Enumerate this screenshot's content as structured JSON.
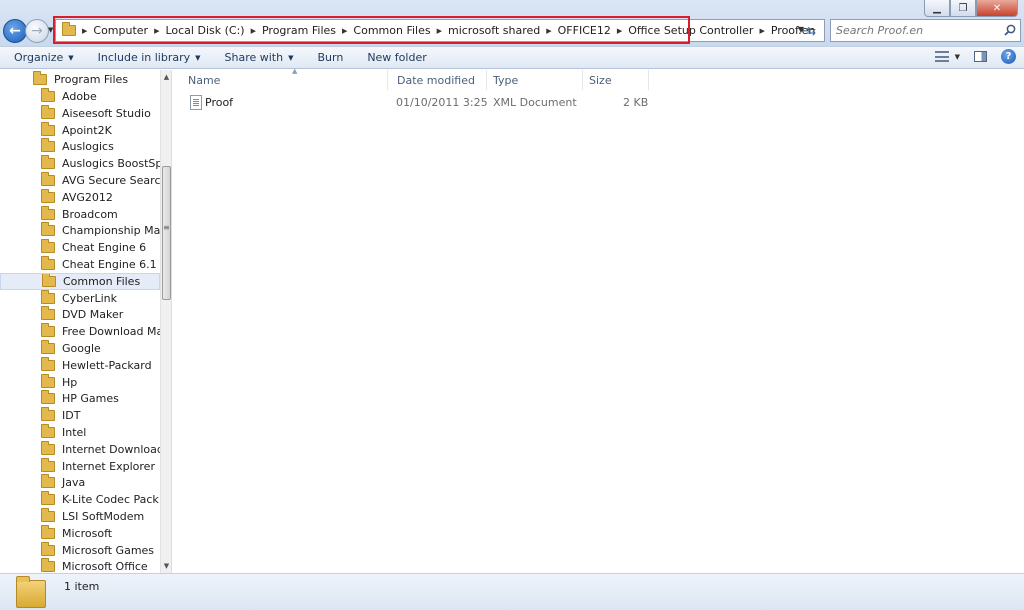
{
  "window": {
    "minimize_glyph": "▁",
    "maximize_glyph": "❐",
    "close_glyph": "✕"
  },
  "address_bar": {
    "crumbs": [
      "Computer",
      "Local Disk (C:)",
      "Program Files",
      "Common Files",
      "microsoft shared",
      "OFFICE12",
      "Office Setup Controller",
      "Proof.en"
    ]
  },
  "search": {
    "placeholder": "Search Proof.en"
  },
  "toolbar": {
    "organize": "Organize",
    "include_in_library": "Include in library",
    "share_with": "Share with",
    "burn": "Burn",
    "new_folder": "New folder"
  },
  "nav_tree": {
    "root": "Program Files",
    "selected": "Common Files",
    "items": [
      "Adobe",
      "Aiseesoft Studio",
      "Apoint2K",
      "Auslogics",
      "Auslogics BoostSpeed",
      "AVG Secure Search",
      "AVG2012",
      "Broadcom",
      "Championship Manager",
      "Cheat Engine 6",
      "Cheat Engine 6.1",
      "Common Files",
      "CyberLink",
      "DVD Maker",
      "Free Download Manager",
      "Google",
      "Hewlett-Packard",
      "Hp",
      "HP Games",
      "IDT",
      "Intel",
      "Internet Download Manager",
      "Internet Explorer",
      "Java",
      "K-Lite Codec Pack",
      "LSI SoftModem",
      "Microsoft",
      "Microsoft Games",
      "Microsoft Office"
    ]
  },
  "file_list": {
    "columns": {
      "name": "Name",
      "date_modified": "Date modified",
      "type": "Type",
      "size": "Size"
    },
    "files": [
      {
        "name": "Proof",
        "date_modified": "01/10/2011 3:25",
        "type": "XML Document",
        "size": "2 KB"
      }
    ]
  },
  "status": {
    "item_count": "1 item"
  },
  "colors": {
    "highlight_box": "#d81d2c",
    "folder": "#e3b84d"
  },
  "icons": [
    "back-arrow-icon",
    "forward-arrow-icon",
    "folder-icon",
    "refresh-icon",
    "search-icon",
    "views-icon",
    "preview-pane-icon",
    "help-icon",
    "xml-document-icon"
  ]
}
